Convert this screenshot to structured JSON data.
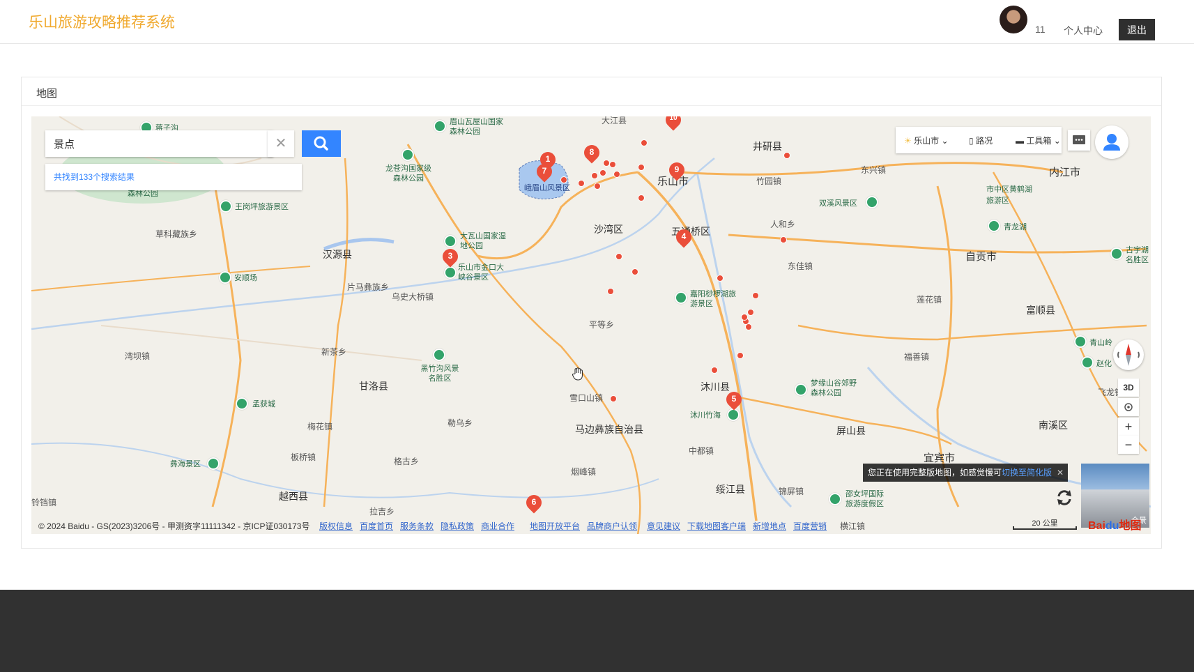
{
  "header": {
    "brand": "乐山旅游攻略推荐系统",
    "username": "11",
    "center_link": "个人中心",
    "logout_label": "退出"
  },
  "card": {
    "title": "地图"
  },
  "map": {
    "search": {
      "value": "景点",
      "result_text": "共找到133个搜索结果"
    },
    "toolbar": {
      "city": "乐山市",
      "traffic": "路况",
      "tools": "工具箱"
    },
    "controls": {
      "three_d": "3D",
      "zoom_in": "+",
      "zoom_out": "−"
    },
    "notice": {
      "text": "您正在使用完整版地图，如感觉慢可",
      "link": "切换至简化版"
    },
    "pano_label": "全景",
    "scale_label": "20 公里",
    "logo": "Bai地图",
    "copyright": "© 2024 Baidu - GS(2023)3206号 - 甲测资字11111342 - 京ICP证030173号",
    "footer_links": [
      "版权信息",
      "百度首页",
      "服务条款",
      "隐私政策",
      "商业合作",
      "地图开放平台",
      "品牌商户认领",
      "意见建议",
      "下载地图客户端",
      "新增地点",
      "百度营销"
    ],
    "place_labels": [
      "乐山市",
      "井研县",
      "内江市",
      "自贡市",
      "宜宾市",
      "汉源县",
      "甘洛县",
      "越西县",
      "沐川县",
      "马边彝族自治县",
      "屏山县",
      "富顺县",
      "南溪区",
      "沙湾区",
      "五通桥区",
      "东兴镇",
      "竹园镇",
      "人和乡",
      "东佳镇",
      "莲花镇",
      "福善镇",
      "飞龙镇",
      "平等乡",
      "雪口山镇",
      "勒乌乡",
      "格古乡",
      "板桥镇",
      "梅花镇",
      "新茶乡",
      "片马彝族乡",
      "乌史大桥镇",
      "草科藏族乡",
      "湾坝镇",
      "中都镇",
      "烟峰镇",
      "拉吉乡",
      "锦屏镇",
      "绥江县",
      "横江镇",
      "铃铛镇",
      "大江县",
      "市中区黄鹤湖旅游区"
    ],
    "poi_labels": [
      "眉山瓦屋山国家森林公园",
      "龙苍沟国家级森林公园",
      "峨眉山风景区",
      "王岗坪旅游景区",
      "大瓦山国家湿地公园",
      "乐山市金口大峡谷景区",
      "安顺场",
      "黑竹沟风景名胜区",
      "孟获城",
      "彝海景区",
      "双溪风景区",
      "青龙湖",
      "嘉阳桫椤湖旅游景区",
      "沐川竹海",
      "梦缘山谷郊野森林公园",
      "邵女坪国际旅游度假区",
      "青山岭",
      "赵化",
      "古宇湖名胜区",
      "蒋子沟",
      "森林公园"
    ],
    "markers": [
      "1",
      "3",
      "4",
      "5",
      "6",
      "7",
      "8",
      "9",
      "10"
    ]
  }
}
